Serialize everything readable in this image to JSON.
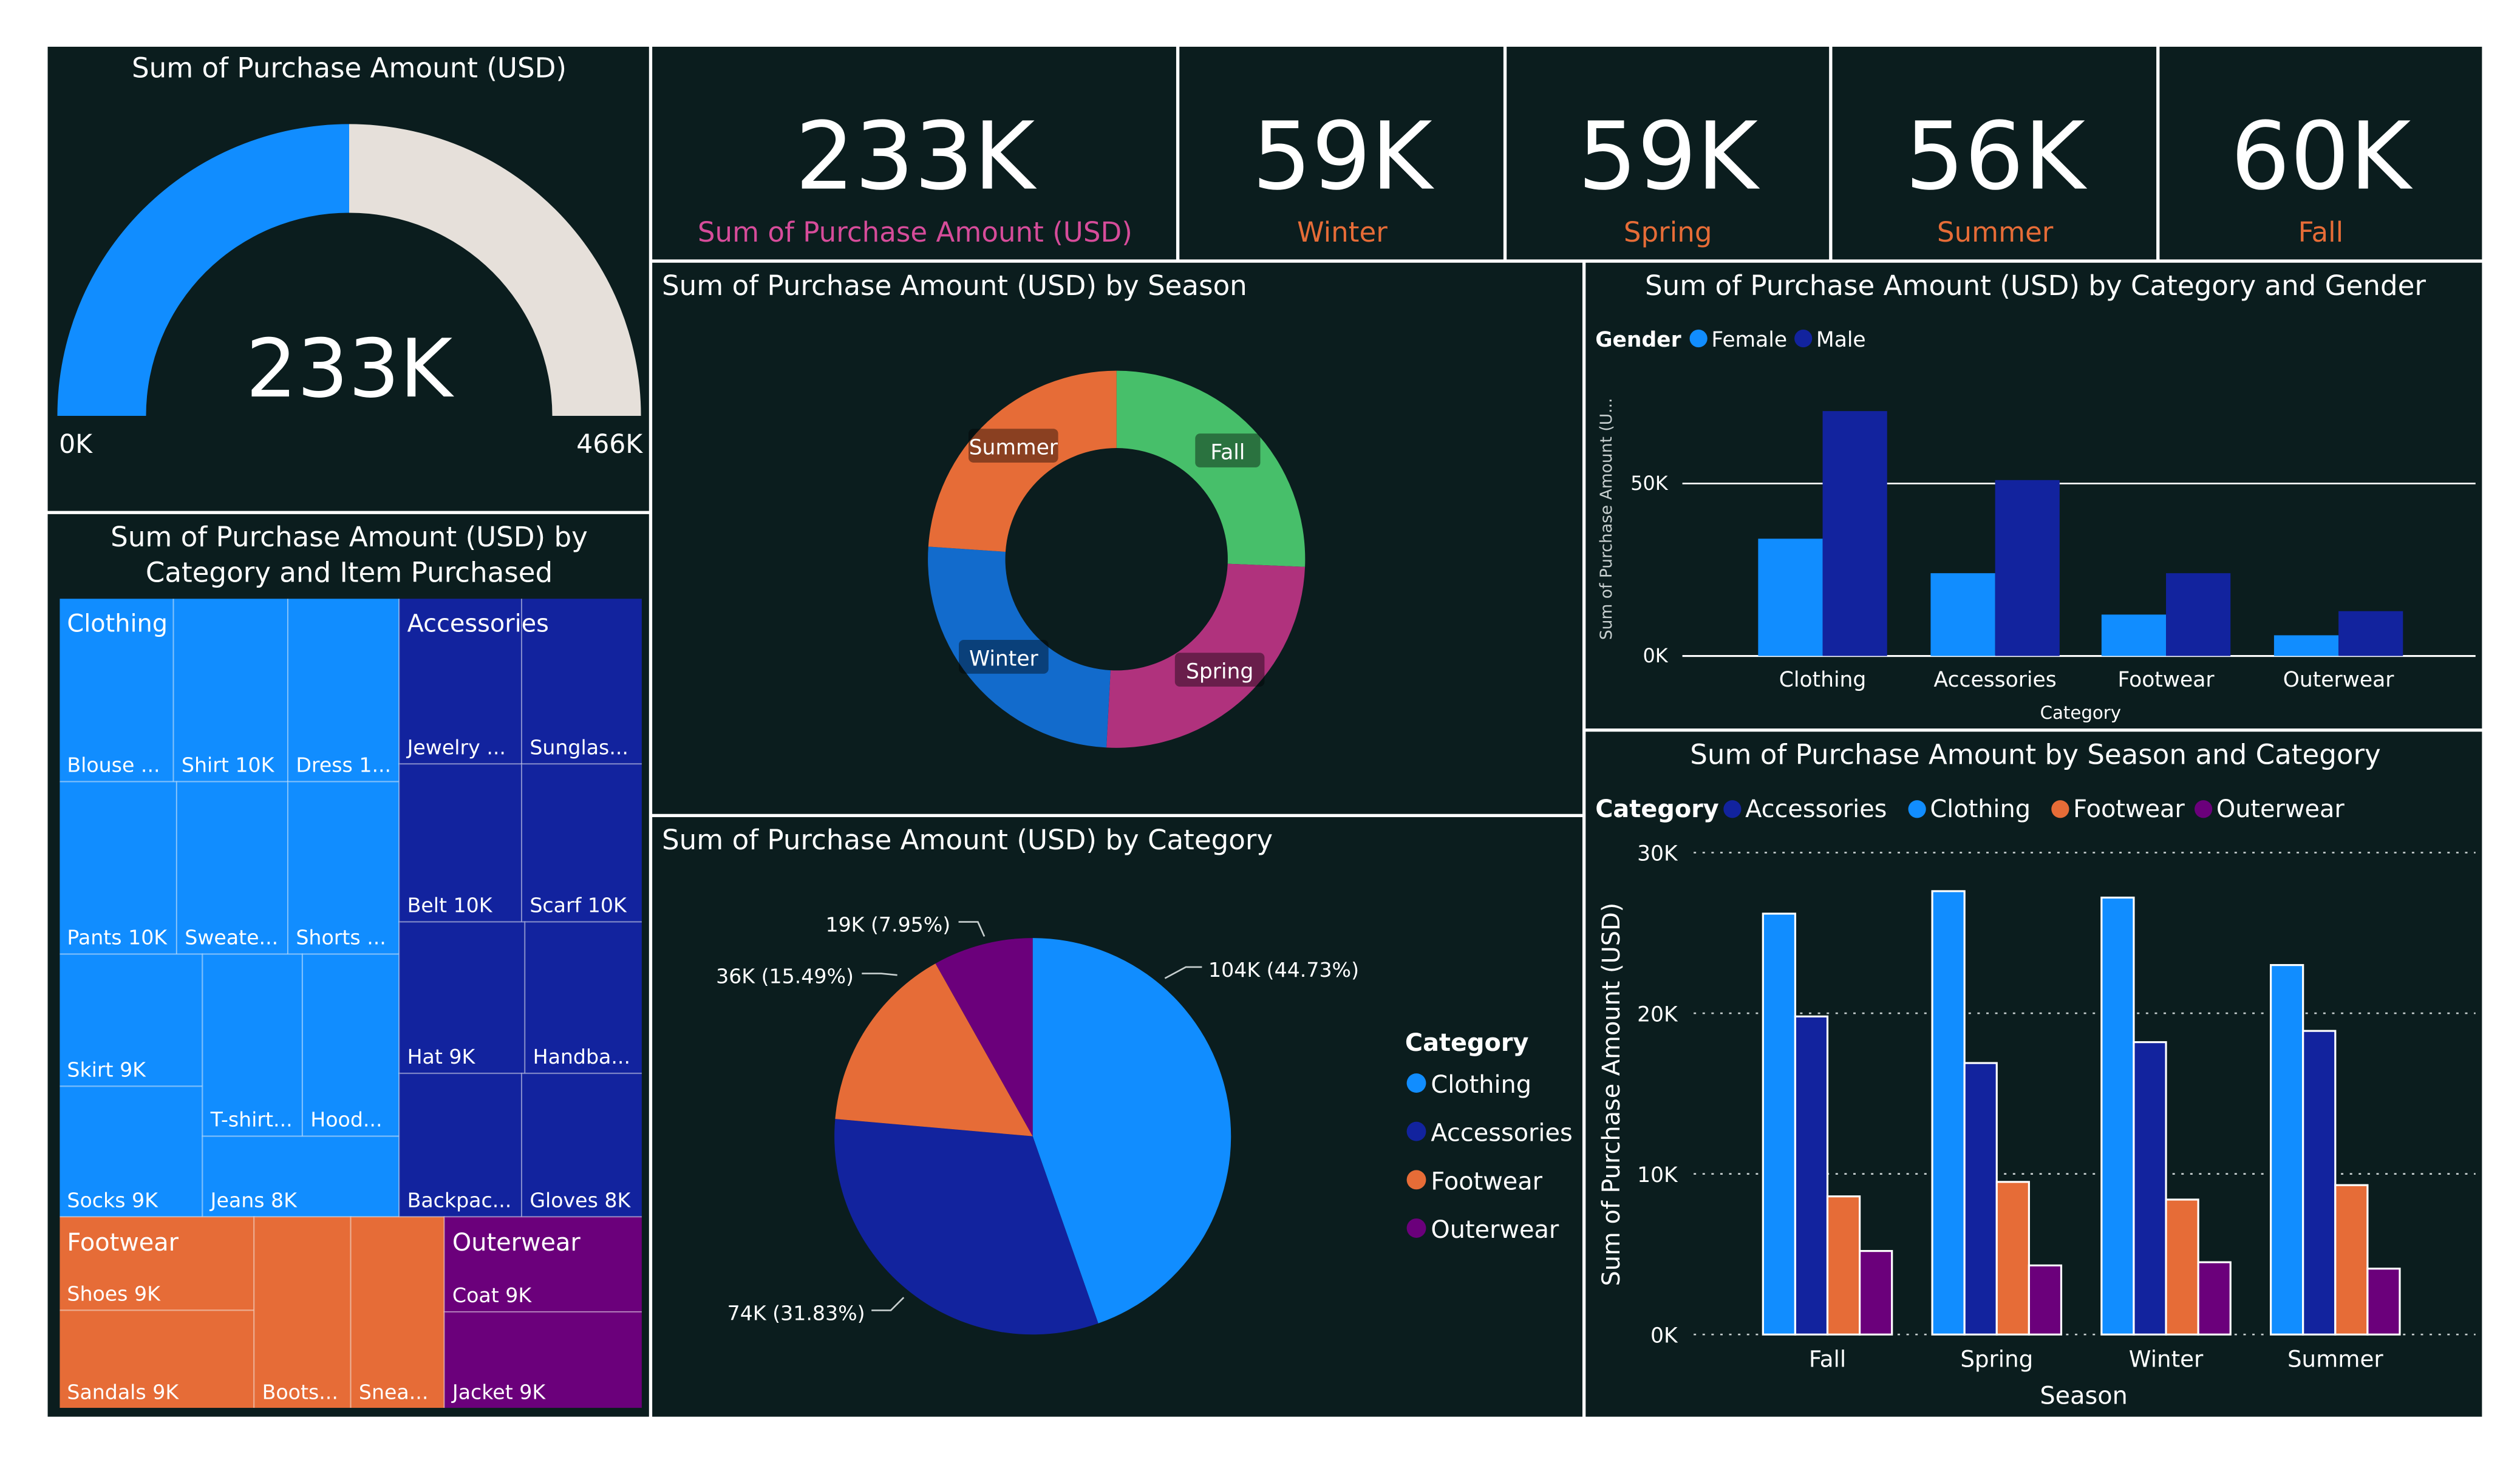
{
  "colors": {
    "page_bg": "#ffffff",
    "panel": "#0b1d1e",
    "clothing": "#118dff",
    "accessories": "#12239e",
    "footwear": "#e66c37",
    "outerwear": "#6b007b",
    "fall": "#47bf6a",
    "spring": "#b0327d",
    "winter": "#126bcc",
    "summer": "#e66c37",
    "gauge_track": "#e6e0da",
    "kpi_total": "#d64c9a",
    "kpi_season": "#e66c37",
    "text": "#ffffff",
    "muted": "#c8d0d0"
  },
  "gauge": {
    "title": "Sum of Purchase Amount (USD)",
    "value": 233,
    "max": 466,
    "value_label": "233K",
    "min_label": "0K",
    "max_label": "466K"
  },
  "kpis": [
    {
      "value": "233K",
      "label": "Sum of Purchase Amount (USD)",
      "kind": "total"
    },
    {
      "value": "59K",
      "label": "Winter",
      "kind": "season"
    },
    {
      "value": "59K",
      "label": "Spring",
      "kind": "season"
    },
    {
      "value": "56K",
      "label": "Summer",
      "kind": "season"
    },
    {
      "value": "60K",
      "label": "Fall",
      "kind": "season"
    }
  ],
  "treemap": {
    "title_line1": "Sum of Purchase Amount (USD) by",
    "title_line2": "Category and Item Purchased",
    "groups": [
      {
        "name": "Clothing",
        "color_key": "clothing",
        "items": [
          {
            "label": "Blouse ..."
          },
          {
            "label": "Shirt 10K"
          },
          {
            "label": "Dress 1..."
          },
          {
            "label": "Pants 10K"
          },
          {
            "label": "Sweate..."
          },
          {
            "label": "Shorts ..."
          },
          {
            "label": "Skirt 9K"
          },
          {
            "label": "Socks 9K"
          },
          {
            "label": "T-shirt..."
          },
          {
            "label": "Hood..."
          },
          {
            "label": "Jeans 8K"
          }
        ]
      },
      {
        "name": "Accessories",
        "color_key": "accessories",
        "items": [
          {
            "label": "Jewelry ..."
          },
          {
            "label": "Sunglas..."
          },
          {
            "label": "Belt 10K"
          },
          {
            "label": "Scarf 10K"
          },
          {
            "label": "Hat 9K"
          },
          {
            "label": "Handba..."
          },
          {
            "label": "Backpac..."
          },
          {
            "label": "Gloves 8K"
          }
        ]
      },
      {
        "name": "Footwear",
        "color_key": "footwear",
        "items": [
          {
            "label": "Shoes 9K"
          },
          {
            "label": "Sandals 9K"
          },
          {
            "label": "Boots..."
          },
          {
            "label": "Snea..."
          }
        ]
      },
      {
        "name": "Outerwear",
        "color_key": "outerwear",
        "items": [
          {
            "label": "Coat 9K"
          },
          {
            "label": "Jacket 9K"
          }
        ]
      }
    ]
  },
  "chart_data": [
    {
      "id": "season_donut",
      "type": "pie",
      "title": "Sum of Purchase Amount (USD) by Season",
      "slices": [
        {
          "label": "Fall",
          "value": 60,
          "color_key": "fall"
        },
        {
          "label": "Spring",
          "value": 59,
          "color_key": "spring"
        },
        {
          "label": "Winter",
          "value": 59,
          "color_key": "winter"
        },
        {
          "label": "Summer",
          "value": 56,
          "color_key": "summer"
        }
      ]
    },
    {
      "id": "category_pie",
      "type": "pie",
      "title": "Sum of Purchase Amount (USD) by Category",
      "legend_title": "Category",
      "legend": [
        {
          "label": "Clothing",
          "color_key": "clothing"
        },
        {
          "label": "Accessories",
          "color_key": "accessories"
        },
        {
          "label": "Footwear",
          "color_key": "footwear"
        },
        {
          "label": "Outerwear",
          "color_key": "outerwear"
        }
      ],
      "slices": [
        {
          "label": "Clothing",
          "value": 104,
          "data_label": "104K (44.73%)",
          "color_key": "clothing"
        },
        {
          "label": "Accessories",
          "value": 74,
          "data_label": "74K (31.83%)",
          "color_key": "accessories"
        },
        {
          "label": "Footwear",
          "value": 36,
          "data_label": "36K (15.49%)",
          "color_key": "footwear"
        },
        {
          "label": "Outerwear",
          "value": 19,
          "data_label": "19K (7.95%)",
          "color_key": "outerwear"
        }
      ]
    },
    {
      "id": "gender_bar",
      "type": "bar",
      "title": "Sum of Purchase Amount (USD) by Category and Gender",
      "legend_title": "Gender",
      "xlabel": "Category",
      "ylabel": "Sum of Purchase Amount (U...",
      "categories": [
        "Clothing",
        "Accessories",
        "Footwear",
        "Outerwear"
      ],
      "series": [
        {
          "name": "Female",
          "color_key": "clothing",
          "values": [
            34,
            24,
            12,
            6
          ]
        },
        {
          "name": "Male",
          "color_key": "accessories",
          "values": [
            71,
            51,
            24,
            13
          ]
        }
      ],
      "ylim": [
        0,
        80
      ],
      "yticks": [
        {
          "v": 0,
          "label": "0K"
        },
        {
          "v": 50,
          "label": "50K"
        }
      ],
      "grid": true
    },
    {
      "id": "season_category_bar",
      "type": "bar",
      "title": "Sum of Purchase Amount by Season and Category",
      "legend_title": "Category",
      "xlabel": "Season",
      "ylabel": "Sum of Purchase Amount (USD)",
      "categories": [
        "Fall",
        "Spring",
        "Winter",
        "Summer"
      ],
      "series": [
        {
          "name": "Clothing",
          "color_key": "clothing",
          "values": [
            26.2,
            27.6,
            27.2,
            23.0
          ]
        },
        {
          "name": "Accessories",
          "color_key": "accessories",
          "values": [
            19.8,
            16.9,
            18.2,
            18.9
          ]
        },
        {
          "name": "Footwear",
          "color_key": "footwear",
          "values": [
            8.6,
            9.5,
            8.4,
            9.3
          ]
        },
        {
          "name": "Outerwear",
          "color_key": "outerwear",
          "values": [
            5.2,
            4.3,
            4.5,
            4.1
          ]
        }
      ],
      "legend_order": [
        "Accessories",
        "Clothing",
        "Footwear",
        "Outerwear"
      ],
      "ylim": [
        0,
        30
      ],
      "yticks": [
        {
          "v": 0,
          "label": "0K"
        },
        {
          "v": 10,
          "label": "10K"
        },
        {
          "v": 20,
          "label": "20K"
        },
        {
          "v": 30,
          "label": "30K"
        }
      ],
      "grid": "dotted"
    }
  ]
}
